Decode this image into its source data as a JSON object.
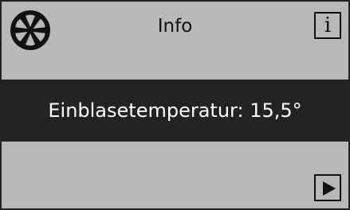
{
  "header": {
    "fan_icon": "fan-icon",
    "title": "Info",
    "info_button_label": "i"
  },
  "main": {
    "label": "Einblasetemperatur:",
    "value": "15,5°"
  },
  "footer": {
    "next_icon": "play-icon"
  },
  "colors": {
    "background": "#b8b8b8",
    "band": "#232323",
    "band_text": "#ffffff",
    "foreground": "#111111"
  }
}
